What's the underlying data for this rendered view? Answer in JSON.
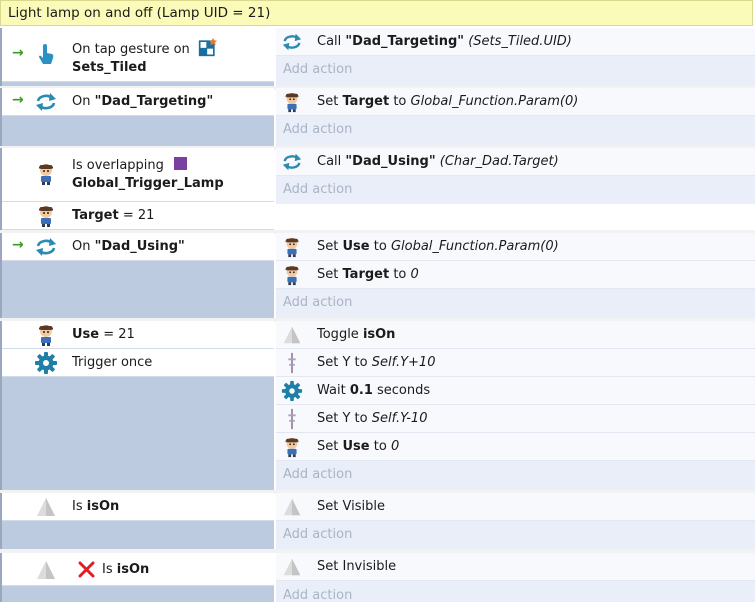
{
  "group": {
    "title": "Light lamp on and off (Lamp UID = 21)"
  },
  "add_action_label": "Add action",
  "events": [
    {
      "trigger_arrow": "→",
      "conditions": [
        {
          "icon": "touch-icon",
          "line1": "On tap gesture on",
          "object": "Sets_Tiled",
          "object_icon": "tiled-sprite-icon"
        }
      ],
      "actions": [
        {
          "icon": "function-icon",
          "prefix": "Call ",
          "name": "\"Dad_Targeting\"",
          "args": "(Sets_Tiled.UID)"
        }
      ]
    },
    {
      "trigger_arrow": "→",
      "conditions": [
        {
          "icon": "function-icon",
          "prefix": "On ",
          "name": "\"Dad_Targeting\""
        }
      ],
      "actions": [
        {
          "icon": "dad-sprite-icon",
          "prefix": "Set ",
          "var": "Target",
          "mid": " to ",
          "value": "Global_Function.Param(0)"
        }
      ]
    },
    {
      "conditions": [
        {
          "icon": "dad-sprite-icon",
          "line1": "Is overlapping",
          "object": "Global_Trigger_Lamp",
          "object_icon": "purple-square-icon"
        },
        {
          "icon": "dad-sprite-icon",
          "var": "Target",
          "op": " = 21"
        }
      ],
      "actions": [
        {
          "icon": "function-icon",
          "prefix": "Call ",
          "name": "\"Dad_Using\"",
          "args": "(Char_Dad.Target)"
        }
      ]
    },
    {
      "trigger_arrow": "→",
      "conditions": [
        {
          "icon": "function-icon",
          "prefix": "On ",
          "name": "\"Dad_Using\""
        }
      ],
      "actions": [
        {
          "icon": "dad-sprite-icon",
          "prefix": "Set ",
          "var": "Use",
          "mid": " to ",
          "value": "Global_Function.Param(0)"
        },
        {
          "icon": "dad-sprite-icon",
          "prefix": "Set ",
          "var": "Target",
          "mid": " to ",
          "value": "0"
        }
      ]
    },
    {
      "conditions": [
        {
          "icon": "dad-sprite-icon",
          "var": "Use",
          "op": " = 21"
        },
        {
          "icon": "gear-icon",
          "text": "Trigger once"
        }
      ],
      "actions": [
        {
          "icon": "lamp-icon",
          "prefix": "Toggle ",
          "var": "isOn"
        },
        {
          "icon": "lamp-pole-icon",
          "prefix": "Set Y to ",
          "value": "Self.Y+10"
        },
        {
          "icon": "gear-icon",
          "prefix": "Wait ",
          "var": "0.1",
          "suffix": " seconds"
        },
        {
          "icon": "lamp-pole-icon",
          "prefix": "Set Y to ",
          "value": "Self.Y-10"
        },
        {
          "icon": "dad-sprite-icon",
          "prefix": "Set ",
          "var": "Use",
          "mid": " to ",
          "value": "0"
        }
      ]
    },
    {
      "conditions": [
        {
          "icon": "lamp-icon",
          "prefix": "Is ",
          "var": "isOn"
        }
      ],
      "actions": [
        {
          "icon": "lamp-icon",
          "text": "Set Visible"
        }
      ]
    },
    {
      "conditions": [
        {
          "icon": "lamp-icon",
          "invert_icon": "red-x-icon",
          "prefix": "Is ",
          "var": "isOn"
        }
      ],
      "actions": [
        {
          "icon": "lamp-icon",
          "text": "Set Invisible"
        }
      ]
    }
  ],
  "colors": {
    "group_header": "#fbfbb9",
    "condition_panel": "#bccbe0",
    "action_panel": "#e9eef8",
    "trigger_arrow": "#3a9d23",
    "function_icon": "#2a8ab0",
    "invert_x": "#e02020"
  }
}
